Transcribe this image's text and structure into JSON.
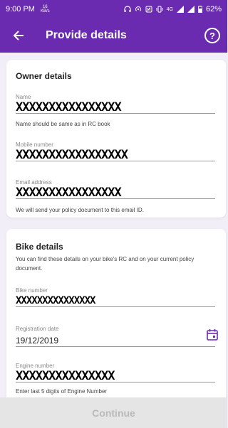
{
  "status_bar": {
    "time": "9:00 PM",
    "net_speed_value": "16",
    "net_speed_unit": "KB/s",
    "signal_label": "4G",
    "battery": "62%"
  },
  "app_bar": {
    "title": "Provide details"
  },
  "owner": {
    "title": "Owner details",
    "name": {
      "label": "Name",
      "value": "XXXXXXXXXXXXXXXX",
      "helper": "Name should be same as in RC book"
    },
    "mobile": {
      "label": "Mobile number",
      "value": "XXXXXXXXXXXXXXXXX"
    },
    "email": {
      "label": "Email address",
      "value": "XXXXXXXXXXXXXXXX",
      "helper": "We will send your policy document to this email ID."
    }
  },
  "bike": {
    "title": "Bike details",
    "description": "You can find these details on your bike's RC and on your current policy document.",
    "bike_number": {
      "label": "Bike number",
      "value": "XXXXXXXXXXXXXXX"
    },
    "registration_date": {
      "label": "Registration date",
      "value": "19/12/2019"
    },
    "engine_number": {
      "label": "Engine number",
      "value": "XXXXXXXXXXXXXXX",
      "helper": "Enter last 5 digits of Engine Number"
    }
  },
  "footer": {
    "continue_label": "Continue"
  },
  "colors": {
    "primary": "#6a2bb0",
    "background": "#f2eef8",
    "disabled_button": "#e5e5e5"
  },
  "icons": {
    "back": "arrow-left-icon",
    "help": "help-circle-icon",
    "calendar": "calendar-icon"
  }
}
